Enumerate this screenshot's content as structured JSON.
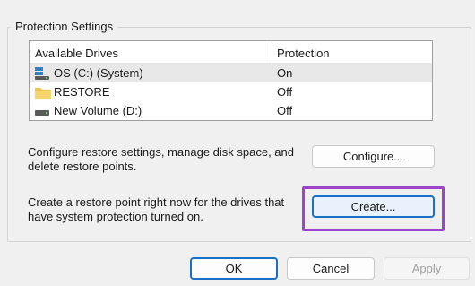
{
  "group": {
    "title": "Protection Settings"
  },
  "drives_table": {
    "columns": [
      "Available Drives",
      "Protection"
    ],
    "rows": [
      {
        "name": "OS (C:) (System)",
        "protection": "On",
        "icon": "system-drive-icon",
        "selected": true
      },
      {
        "name": "RESTORE",
        "protection": "Off",
        "icon": "folder-icon",
        "selected": false
      },
      {
        "name": "New Volume (D:)",
        "protection": "Off",
        "icon": "drive-icon",
        "selected": false
      }
    ]
  },
  "configure": {
    "description_line1": "Configure restore settings, manage disk space, and",
    "description_line2": "delete restore points.",
    "button_label": "Configure..."
  },
  "create": {
    "description_line1": "Create a restore point right now for the drives that",
    "description_line2": "have system protection turned on.",
    "button_label": "Create..."
  },
  "footer": {
    "ok_label": "OK",
    "cancel_label": "Cancel",
    "apply_label": "Apply"
  },
  "colors": {
    "highlight_border": "#9b45c9",
    "focus_blue": "#1a6fc7",
    "selected_row": "#e8e8e8"
  }
}
